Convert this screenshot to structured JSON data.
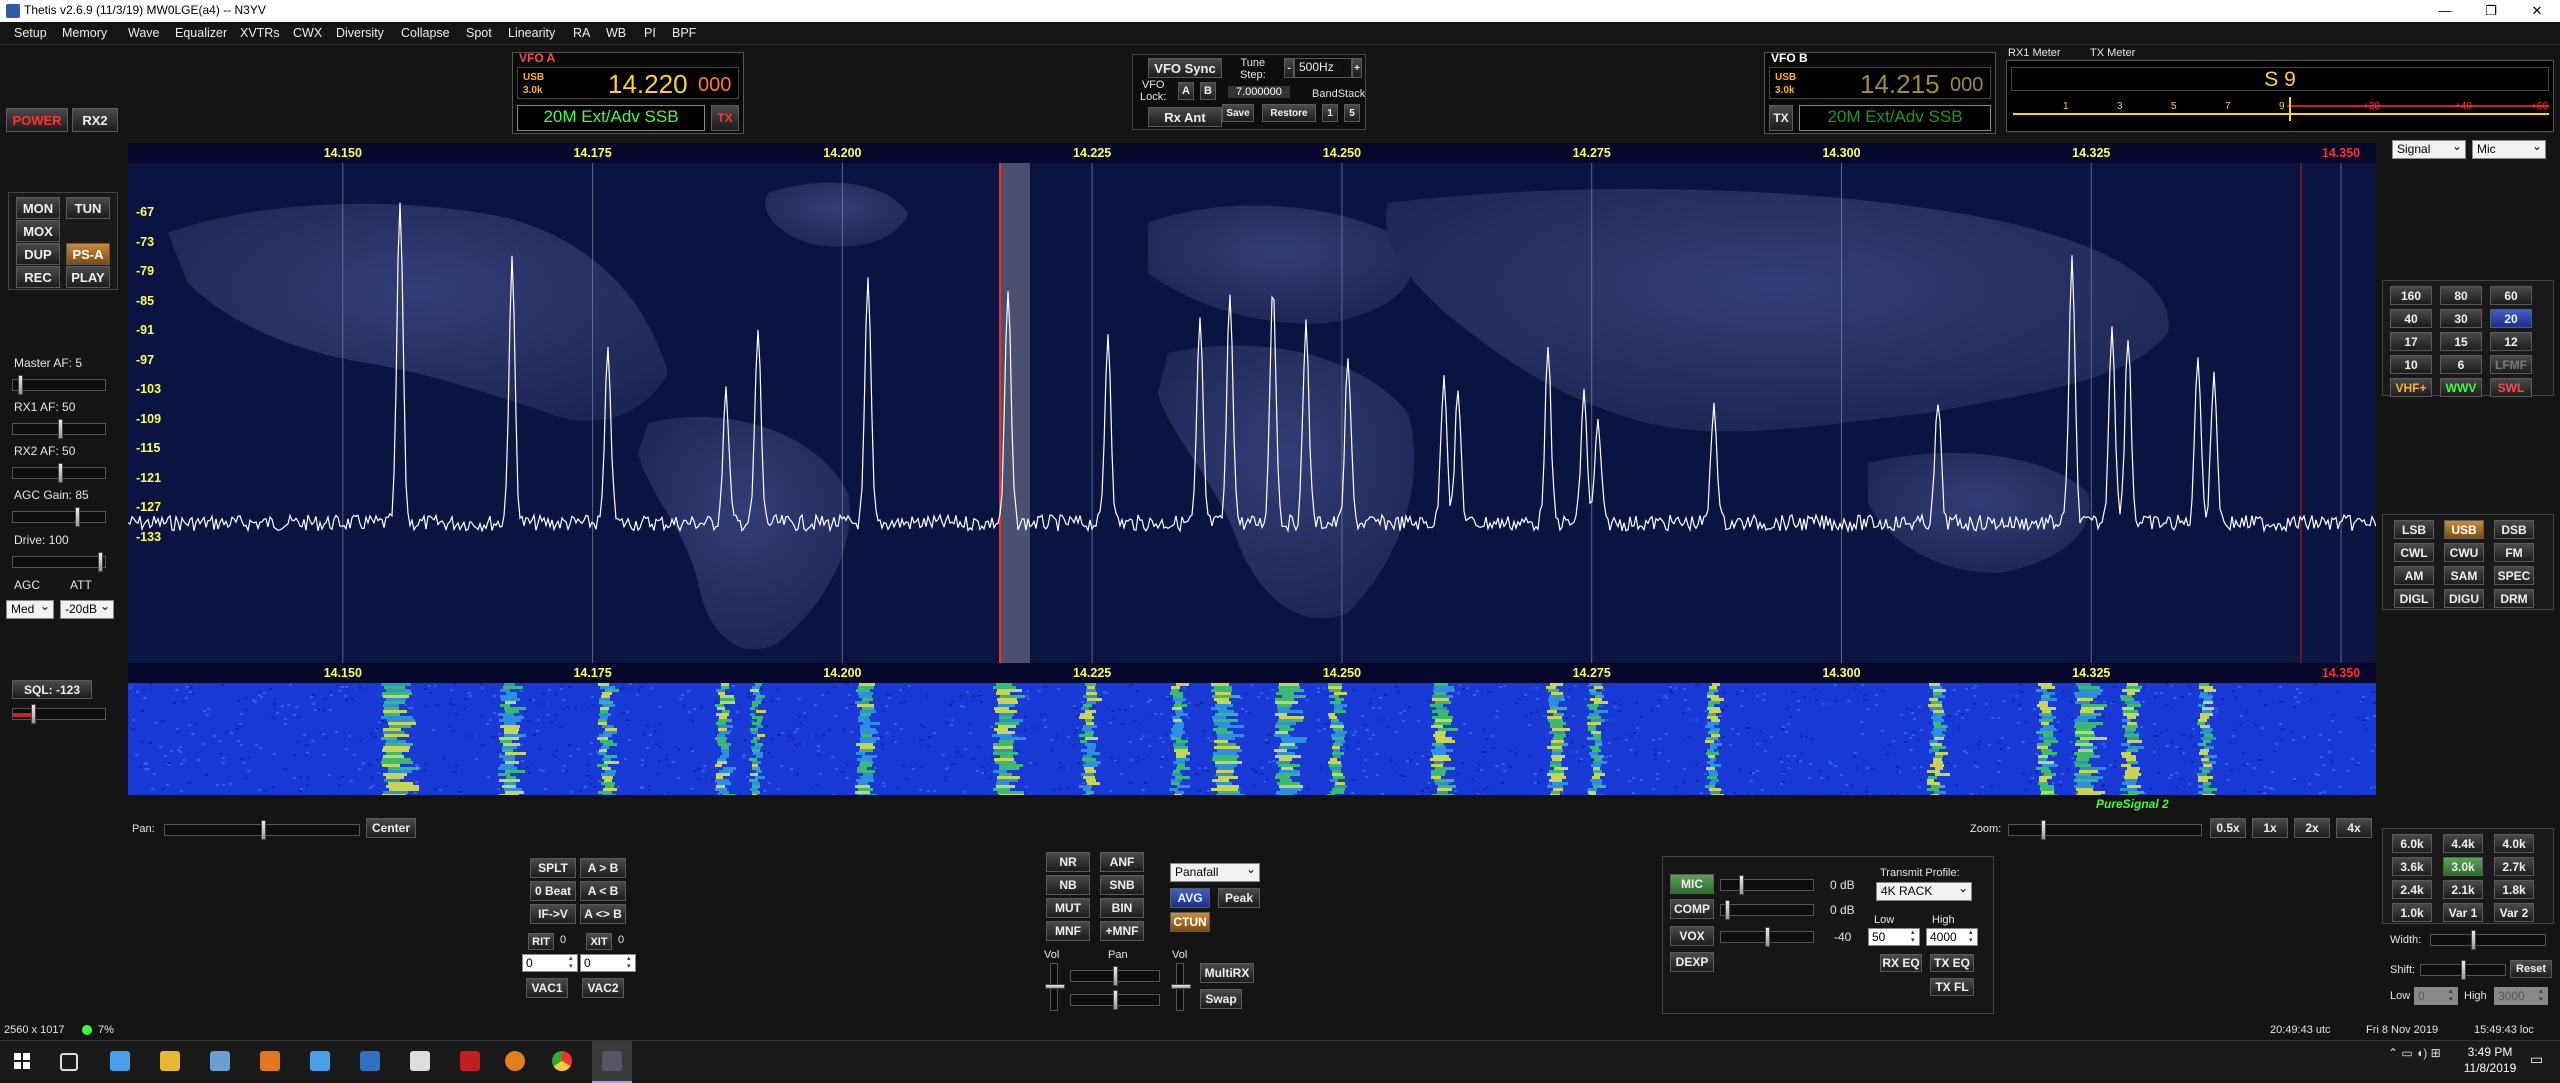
{
  "window": {
    "title": "Thetis v2.6.9 (11/3/19) MW0LGE(a4)   --   N3YV",
    "controls": [
      "—",
      "❐",
      "✕"
    ]
  },
  "menu": [
    "Setup",
    "Memory",
    "Wave",
    "Equalizer",
    "XVTRs",
    "CWX",
    "Diversity",
    "Collapse",
    "Spot",
    "Linearity",
    "RA",
    "WB",
    "PI",
    "BPF"
  ],
  "left": {
    "power": "POWER",
    "rx2": "RX2",
    "buttons": [
      "MON",
      "TUN",
      "MOX",
      "DUP",
      "PS-A",
      "REC",
      "PLAY"
    ],
    "master_af": "Master AF:  5",
    "rx1_af": "RX1 AF:  50",
    "rx2_af": "RX2 AF:  50",
    "agc_gain": "AGC Gain:  85",
    "drive": "Drive:  100",
    "agc_label": "AGC",
    "att_label": "ATT",
    "agc_value": "Med",
    "att_value": "-20dB",
    "sql": "SQL:  -123",
    "sql_pct": 0.2
  },
  "vfoa": {
    "label": "VFO A",
    "mode": "USB",
    "bw": "3.0k",
    "freq_main": "14.220",
    "freq_sub": "000",
    "band": "20M Ext/Adv SSB",
    "tx": "TX"
  },
  "center_ctrl": {
    "vfo_sync": "VFO Sync",
    "tune_step_label": "Tune\nStep:",
    "tune_step": "500Hz",
    "vfo_lock": "VFO\nLock:",
    "a": "A",
    "b": "B",
    "lock_value": "7.000000",
    "bandstack": "BandStack",
    "rx_ant": "Rx Ant",
    "save": "Save",
    "restore": "Restore",
    "one": "1",
    "five": "5"
  },
  "vfob": {
    "label": "VFO B",
    "mode": "USB",
    "bw": "3.0k",
    "freq_main": "14.215",
    "freq_sub": "000",
    "band": "20M Ext/Adv SSB",
    "tx": "TX"
  },
  "meter": {
    "rx1_label": "RX1 Meter",
    "tx_label": "TX Meter",
    "value": "S 9",
    "scale": [
      "1",
      "3",
      "5",
      "7",
      "9",
      "+20",
      "+40",
      "+60"
    ],
    "signal": "Signal",
    "mic": "Mic"
  },
  "panadapter": {
    "freq_labels": [
      "14.150",
      "14.175",
      "14.200",
      "14.225",
      "14.250",
      "14.275",
      "14.300",
      "14.325",
      "14.350"
    ],
    "db_labels": [
      "-67",
      "-73",
      "-79",
      "-85",
      "-91",
      "-97",
      "-103",
      "-109",
      "-115",
      "-121",
      "-127",
      "-133"
    ],
    "puresignal": "PureSignal 2"
  },
  "bands": [
    "160",
    "80",
    "60",
    "40",
    "30",
    "20",
    "17",
    "15",
    "12",
    "10",
    "6",
    "LFMF",
    "VHF+",
    "WWV",
    "SWL"
  ],
  "modes": [
    "LSB",
    "USB",
    "DSB",
    "CWL",
    "CWU",
    "FM",
    "AM",
    "SAM",
    "SPEC",
    "DIGL",
    "DIGU",
    "DRM"
  ],
  "pan_zoom": {
    "pan_label": "Pan:",
    "center": "Center",
    "zoom_label": "Zoom:",
    "zoom_buttons": [
      "0.5x",
      "1x",
      "2x",
      "4x"
    ]
  },
  "split": {
    "buttons": [
      "SPLT",
      "A > B",
      "0 Beat",
      "A < B",
      "IF->V",
      "A <> B"
    ],
    "rit": "RIT",
    "rit_val": "0",
    "xit": "XIT",
    "xit_val": "0",
    "rit_num": "0",
    "xit_num": "0",
    "vac1": "VAC1",
    "vac2": "VAC2"
  },
  "dsp": {
    "buttons": [
      "NR",
      "ANF",
      "NB",
      "SNB",
      "MUT",
      "BIN",
      "MNF",
      "+MNF"
    ],
    "display_mode": "Panafall",
    "avg": "AVG",
    "peak": "Peak",
    "ctun": "CTUN",
    "vol1": "Vol",
    "pan": "Pan",
    "vol2": "Vol",
    "multirx": "MultiRX",
    "swap": "Swap"
  },
  "tx": {
    "mic": "MIC",
    "comp": "COMP",
    "vox": "VOX",
    "dexp": "DEXP",
    "mic_db": "0 dB",
    "comp_db": "0 dB",
    "vox_db": "-40",
    "profile_label": "Transmit Profile:",
    "profile": "4K RACK",
    "low_label": "Low",
    "high_label": "High",
    "low": "50",
    "high": "4000",
    "rx_eq": "RX EQ",
    "tx_eq": "TX EQ",
    "tx_fl": "TX FL"
  },
  "filters": {
    "buttons": [
      "6.0k",
      "4.4k",
      "4.0k",
      "3.6k",
      "3.0k",
      "2.7k",
      "2.4k",
      "2.1k",
      "1.8k",
      "1.0k",
      "Var 1",
      "Var 2"
    ],
    "width": "Width:",
    "shift": "Shift:",
    "reset": "Reset",
    "low": "Low",
    "high": "High",
    "low_val": "0",
    "high_val": "3000"
  },
  "status": {
    "resolution": "2560 x 1017",
    "cpu": "7%",
    "utc": "20:49:43 utc",
    "date": "Fri 8 Nov 2019",
    "loc": "15:49:43 loc"
  },
  "taskbar": {
    "time": "3:49 PM",
    "date": "11/8/2019"
  }
}
